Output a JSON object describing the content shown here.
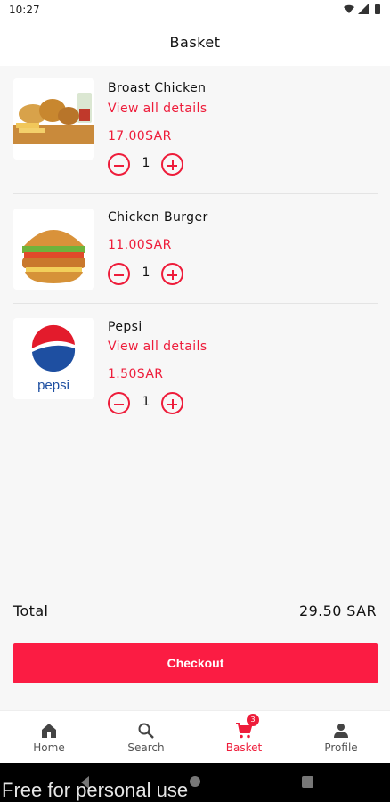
{
  "status_bar": {
    "time": "10:27"
  },
  "header": {
    "title": "Basket"
  },
  "basket": {
    "items": [
      {
        "name": "Broast Chicken",
        "details_link": "View all details",
        "price": "17.00SAR",
        "quantity": "1"
      },
      {
        "name": "Chicken Burger",
        "price": "11.00SAR",
        "quantity": "1"
      },
      {
        "name": "Pepsi",
        "details_link": "View all details",
        "price": "1.50SAR",
        "quantity": "1",
        "image_text": "pepsi"
      }
    ],
    "total_label": "Total",
    "total_value": "29.50 SAR",
    "checkout_label": "Checkout"
  },
  "bottom_nav": {
    "items": [
      {
        "label": "Home",
        "icon": "home-icon"
      },
      {
        "label": "Search",
        "icon": "search-icon"
      },
      {
        "label": "Basket",
        "icon": "cart-icon",
        "badge": "3",
        "active": true
      },
      {
        "label": "Profile",
        "icon": "person-icon"
      }
    ]
  },
  "colors": {
    "accent": "#ee1c3a",
    "checkout": "#fb1c43",
    "background": "#f7f7f7"
  },
  "watermark": "Free for personal use"
}
